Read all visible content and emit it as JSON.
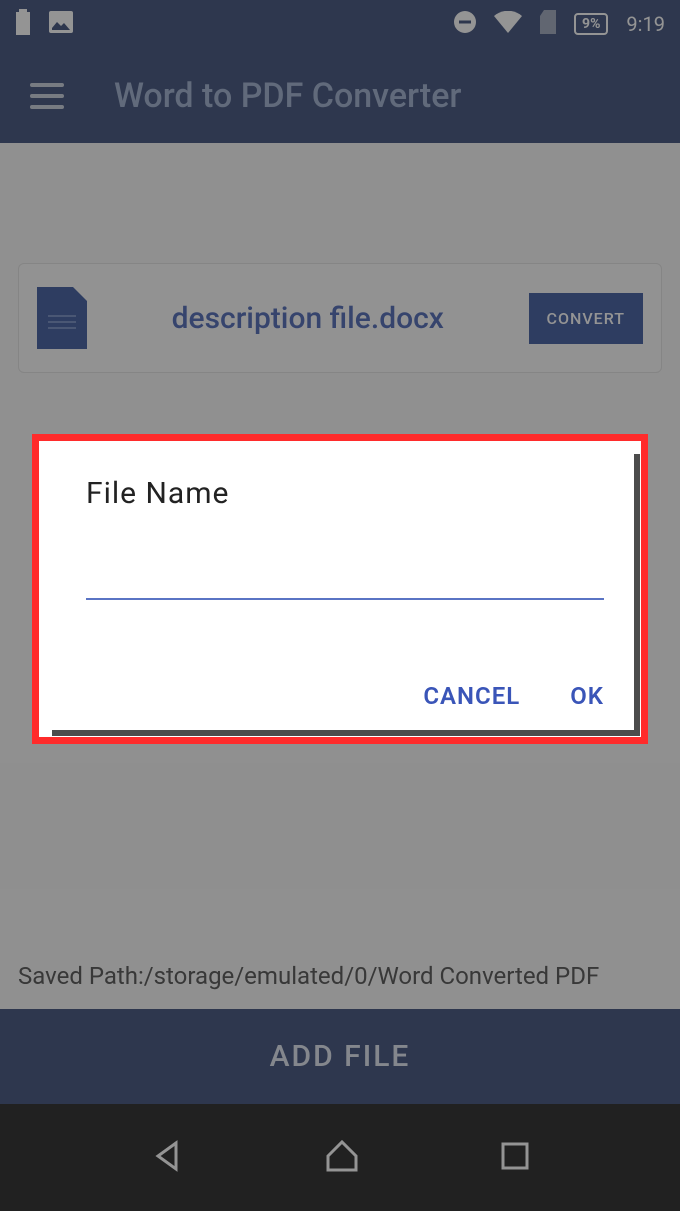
{
  "status_bar": {
    "battery_pct": "9%",
    "time": "9:19"
  },
  "app_bar": {
    "title": "Word to PDF Converter"
  },
  "file_card": {
    "filename": "description file.docx",
    "convert_label": "CONVERT"
  },
  "saved_path": "Saved Path:/storage/emulated/0/Word Converted PDF",
  "add_file_label": "ADD FILE",
  "dialog": {
    "title": "File Name",
    "input_value": "",
    "cancel_label": "CANCEL",
    "ok_label": "OK"
  }
}
